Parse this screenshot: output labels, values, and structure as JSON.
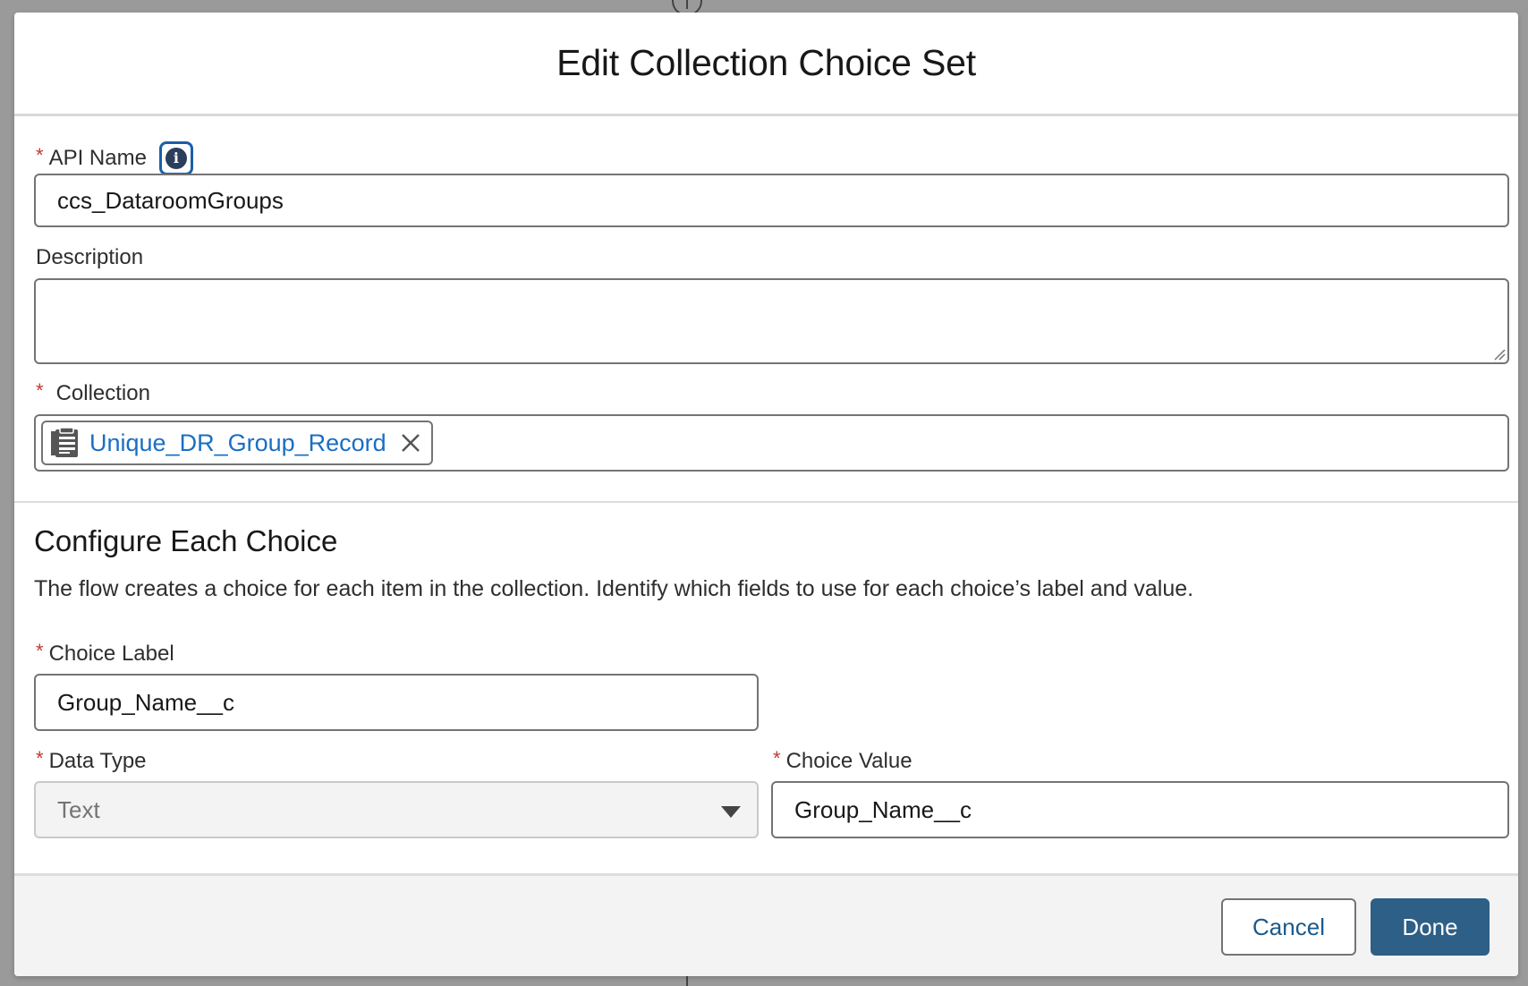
{
  "modal": {
    "title": "Edit Collection Choice Set"
  },
  "fields": {
    "api_name": {
      "label": "API Name",
      "required": "*",
      "value": "ccs_DataroomGroups",
      "info_icon": "info-icon"
    },
    "description": {
      "label": "Description",
      "value": ""
    },
    "collection": {
      "label": "Collection",
      "required": "*",
      "selected": "Unique_DR_Group_Record",
      "pill_icon": "collection-icon",
      "remove_icon": "close-icon"
    }
  },
  "configure": {
    "title": "Configure Each Choice",
    "description": "The flow creates a choice for each item in the collection. Identify which fields to use for each choice’s label and value.",
    "choice_label": {
      "label": "Choice Label",
      "required": "*",
      "value": "Group_Name__c"
    },
    "data_type": {
      "label": "Data Type",
      "required": "*",
      "value": "Text",
      "disabled": true
    },
    "choice_value": {
      "label": "Choice Value",
      "required": "*",
      "value": "Group_Name__c"
    }
  },
  "footer": {
    "cancel_label": "Cancel",
    "done_label": "Done"
  },
  "colors": {
    "brand_button": "#2e5f86",
    "link_blue": "#1b6ec2",
    "required_red": "#c23934",
    "footer_bg": "#f3f3f3",
    "backdrop": "#9a9a9a"
  }
}
